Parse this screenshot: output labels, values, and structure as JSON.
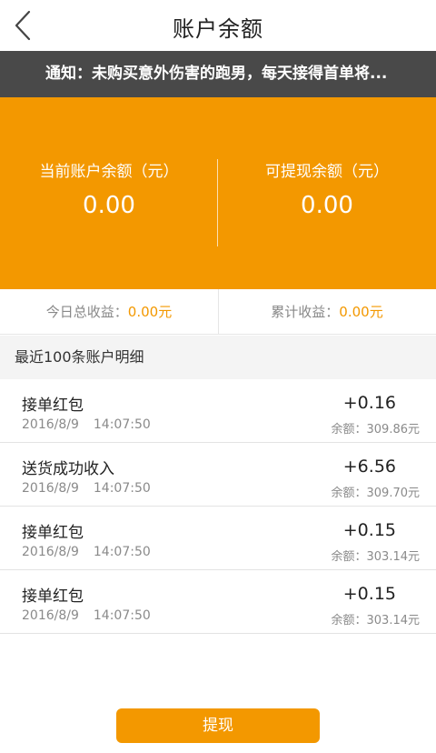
{
  "nav": {
    "title": "账户余额",
    "back_icon": "chevron-left-icon"
  },
  "notice": {
    "text": "通知：未购买意外伤害的跑男，每天接得首单将..."
  },
  "balance": {
    "current_label": "当前账户余额（元）",
    "current_value": "0.00",
    "withdrawable_label": "可提现余额（元）",
    "withdrawable_value": "0.00"
  },
  "earnings": {
    "today_label": "今日总收益：",
    "today_value": "0.00元",
    "total_label": "累计收益：",
    "total_value": "0.00元"
  },
  "section": {
    "title": "最近100条账户明细"
  },
  "records": [
    {
      "name": "接单红包",
      "date": "2016/8/9",
      "time": "14:07:50",
      "delta": "+0.16",
      "remain": "余额：309.86元"
    },
    {
      "name": "送货成功收入",
      "date": "2016/8/9",
      "time": "14:07:50",
      "delta": "+6.56",
      "remain": "余额：309.70元"
    },
    {
      "name": "接单红包",
      "date": "2016/8/9",
      "time": "14:07:50",
      "delta": "+0.15",
      "remain": "余额：303.14元"
    },
    {
      "name": "接单红包",
      "date": "2016/8/9",
      "time": "14:07:50",
      "delta": "+0.15",
      "remain": "余额：303.14元"
    }
  ],
  "actions": {
    "withdraw_label": "提现"
  },
  "colors": {
    "accent": "#f39800",
    "notice_bg": "#494949"
  }
}
